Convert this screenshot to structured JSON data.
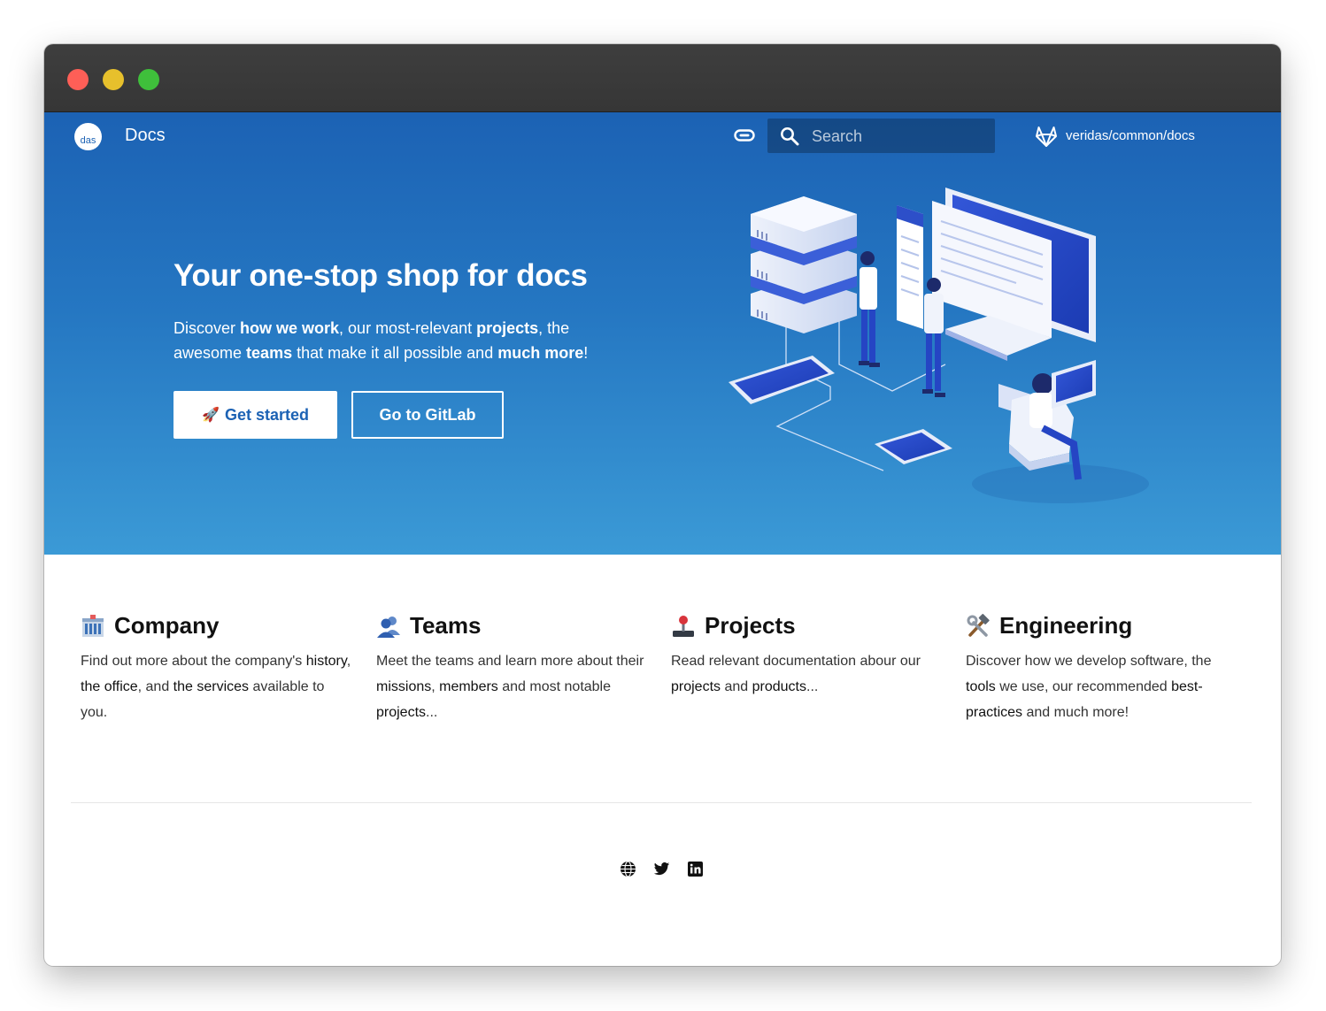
{
  "header": {
    "logo_text": "das",
    "site_title": "Docs",
    "search_placeholder": "Search",
    "repo_label": "veridas/common/docs"
  },
  "hero": {
    "title": "Your one-stop shop for docs",
    "desc": {
      "p1": "Discover ",
      "b1": "how we work",
      "p2": ", our most-relevant ",
      "b2": "projects",
      "p3": ", the awesome ",
      "b3": "teams",
      "p4": " that make it all possible and ",
      "b4": "much more",
      "p5": "!"
    },
    "primary_button": "Get started",
    "primary_button_icon": "🚀",
    "secondary_button": "Go to GitLab"
  },
  "features": [
    {
      "title": "Company",
      "icon": "office-building-icon",
      "parts": [
        "Find out more about the company's ",
        "history",
        ", ",
        "the office",
        ", and ",
        "the services",
        " available to you."
      ]
    },
    {
      "title": "Teams",
      "icon": "people-icon",
      "parts": [
        "Meet the teams and learn more about their ",
        "missions",
        ", ",
        "members",
        " and most notable ",
        "projects",
        "..."
      ]
    },
    {
      "title": "Projects",
      "icon": "joystick-icon",
      "parts": [
        "Read relevant documentation abour our ",
        "projects",
        " and ",
        "products",
        "..."
      ]
    },
    {
      "title": "Engineering",
      "icon": "hammer-wrench-icon",
      "parts": [
        "Discover how we develop software, the ",
        "tools",
        " we use, our recommended ",
        "best-practices",
        " and much more!"
      ]
    }
  ],
  "footer": {
    "social_icons": [
      "globe-icon",
      "twitter-icon",
      "linkedin-icon"
    ]
  },
  "colors": {
    "hero_top": "#1c62b4",
    "hero_bottom": "#3b9ad6",
    "primary_text": "#1c62b4"
  }
}
